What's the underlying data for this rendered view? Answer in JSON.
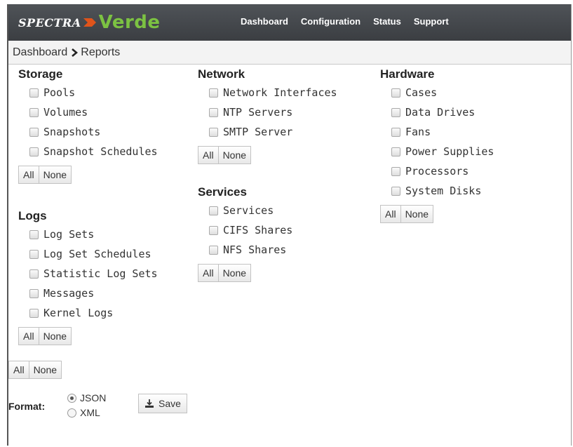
{
  "brand": {
    "spectra": "SPECTRA",
    "verde": "Verde"
  },
  "nav": {
    "dashboard": "Dashboard",
    "configuration": "Configuration",
    "status": "Status",
    "support": "Support"
  },
  "breadcrumb": {
    "home": "Dashboard",
    "current": "Reports"
  },
  "sections": {
    "storage": {
      "title": "Storage",
      "items": [
        "Pools",
        "Volumes",
        "Snapshots",
        "Snapshot Schedules"
      ]
    },
    "logs": {
      "title": "Logs",
      "items": [
        "Log Sets",
        "Log Set Schedules",
        "Statistic Log Sets",
        "Messages",
        "Kernel Logs"
      ]
    },
    "network": {
      "title": "Network",
      "items": [
        "Network Interfaces",
        "NTP Servers",
        "SMTP Server"
      ]
    },
    "services": {
      "title": "Services",
      "items": [
        "Services",
        "CIFS Shares",
        "NFS Shares"
      ]
    },
    "hardware": {
      "title": "Hardware",
      "items": [
        "Cases",
        "Data Drives",
        "Fans",
        "Power Supplies",
        "Processors",
        "System Disks"
      ]
    }
  },
  "buttons": {
    "all": "All",
    "none": "None",
    "save": "Save"
  },
  "format": {
    "label": "Format:",
    "options": [
      "JSON",
      "XML"
    ],
    "selected": "JSON"
  },
  "colors": {
    "topbar": "#45484c",
    "verde": "#7cc242",
    "arrow": "#e0541b"
  }
}
